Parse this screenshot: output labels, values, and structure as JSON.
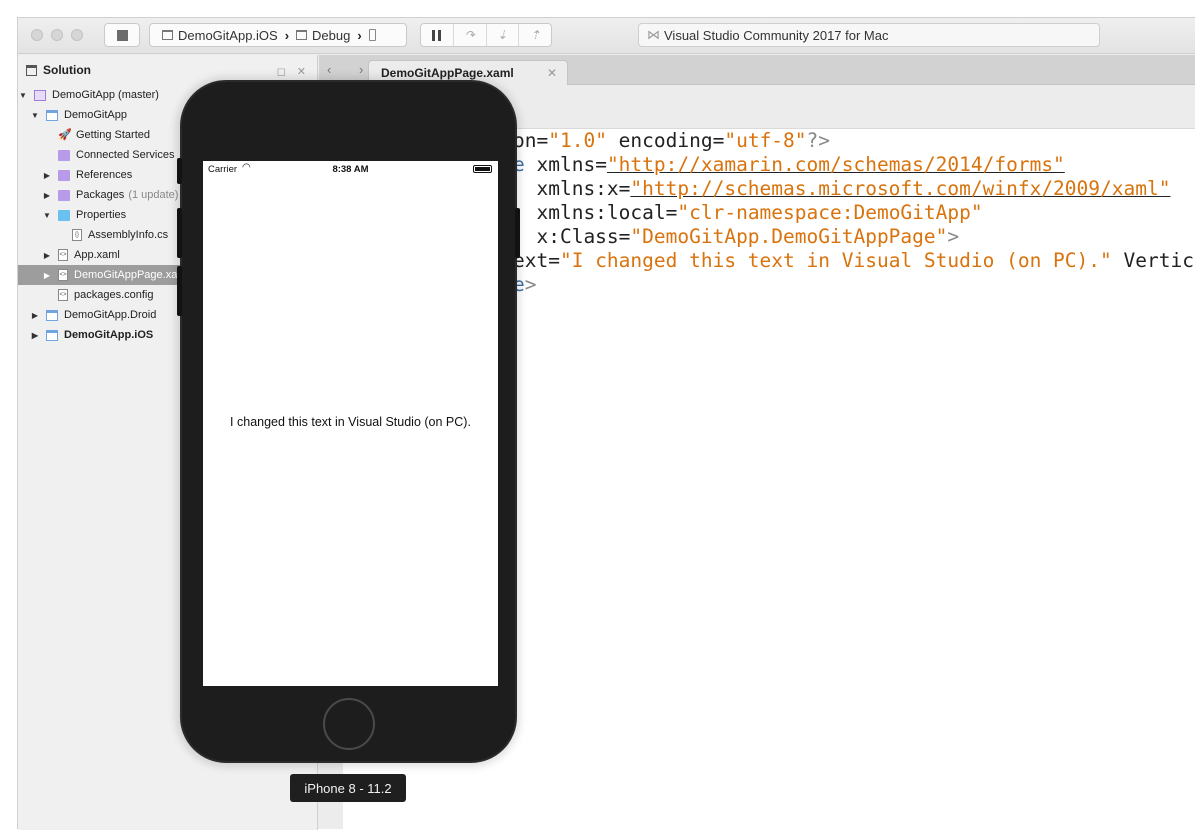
{
  "toolbar": {
    "scheme_project": "DemoGitApp.iOS",
    "scheme_config": "Debug",
    "status_text": "Visual Studio Community 2017 for Mac"
  },
  "solution_pad": {
    "title": "Solution",
    "items": [
      {
        "label": "DemoGitApp (master)",
        "extra": ""
      },
      {
        "label": "DemoGitApp",
        "extra": ""
      },
      {
        "label": "Getting Started",
        "extra": ""
      },
      {
        "label": "Connected Services",
        "extra": ""
      },
      {
        "label": "References",
        "extra": ""
      },
      {
        "label": "Packages",
        "extra": "(1 update)"
      },
      {
        "label": "Properties",
        "extra": ""
      },
      {
        "label": "AssemblyInfo.cs",
        "extra": ""
      },
      {
        "label": "App.xaml",
        "extra": ""
      },
      {
        "label": "DemoGitAppPage.xaml",
        "extra": ""
      },
      {
        "label": "packages.config",
        "extra": ""
      },
      {
        "label": "DemoGitApp.Droid",
        "extra": ""
      },
      {
        "label": "DemoGitApp.iOS",
        "extra": ""
      }
    ]
  },
  "editor": {
    "active_tab": "DemoGitAppPage.xaml",
    "code": {
      "l1_a": "on=",
      "l1_b": "\"1.0\"",
      "l1_c": " encoding=",
      "l1_d": "\"utf-8\"",
      "l1_e": "?>",
      "l2_a": "e",
      "l2_b": " xmlns=",
      "l2_c": "\"http://xamarin.com/schemas/2014/forms\"",
      "l3_a": "  xmlns:x=",
      "l3_b": "\"http://schemas.microsoft.com/winfx/2009/xaml\"",
      "l4_a": "  xmlns:local=",
      "l4_b": "\"clr-namespace:DemoGitApp\"",
      "l5_a": "  x:Class=",
      "l5_b": "\"DemoGitApp.DemoGitAppPage\"",
      "l5_c": ">",
      "l6_a": "ext=",
      "l6_b": "\"I changed this text in Visual Studio (on PC).\"",
      "l6_c": " Vertica",
      "l7_a": "e",
      "l7_b": ">"
    }
  },
  "simulator": {
    "carrier": "Carrier",
    "time": "8:38 AM",
    "app_text": "I changed this text in Visual Studio (on PC).",
    "device_label": "iPhone 8 - 11.2"
  }
}
